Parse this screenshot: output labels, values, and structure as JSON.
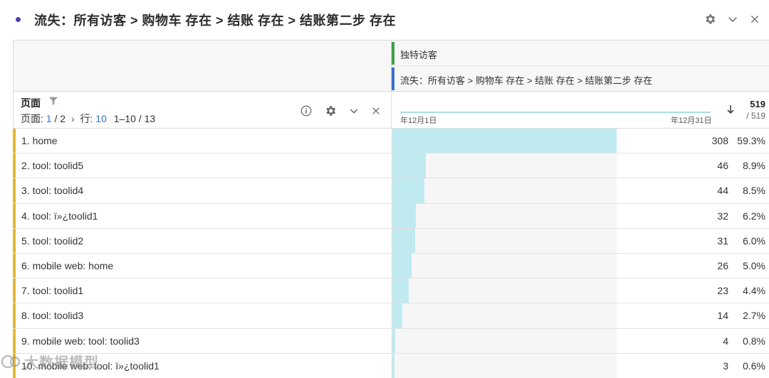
{
  "panel": {
    "title": "流失：所有访客 > 购物车 存在 > 结账 存在 > 结账第二步 存在",
    "icons": [
      "gear-icon",
      "chevron-down-icon",
      "close-icon"
    ]
  },
  "metrics": {
    "primary": "独特访客",
    "segment": "流失：所有访客 > 购物车 存在 > 结账 存在 > 结账第二步 存在",
    "primary_color": "#3fa14a",
    "segment_color": "#3b6fd0"
  },
  "dimension": {
    "title": "页面",
    "pager": {
      "page_label": "页面:",
      "page_current": "1",
      "page_total": "/ 2",
      "rows_label": "行:",
      "rows_per_page": "10",
      "range": "1–10 / 13"
    }
  },
  "trend": {
    "start_date": "年12月1日",
    "end_date": "年12月31日",
    "total": "519",
    "total_of": "/ 519"
  },
  "rows": [
    {
      "label": "1.  home",
      "count": "308",
      "pct": "59.3%",
      "share": 0.593
    },
    {
      "label": "2.  tool: toolid5",
      "count": "46",
      "pct": "8.9%",
      "share": 0.089
    },
    {
      "label": "3.  tool: toolid4",
      "count": "44",
      "pct": "8.5%",
      "share": 0.085
    },
    {
      "label": "4.  tool: ï»¿toolid1",
      "count": "32",
      "pct": "6.2%",
      "share": 0.062
    },
    {
      "label": "5.  tool: toolid2",
      "count": "31",
      "pct": "6.0%",
      "share": 0.06
    },
    {
      "label": "6.  mobile web: home",
      "count": "26",
      "pct": "5.0%",
      "share": 0.05
    },
    {
      "label": "7.  tool: toolid1",
      "count": "23",
      "pct": "4.4%",
      "share": 0.044
    },
    {
      "label": "8.  tool: toolid3",
      "count": "14",
      "pct": "2.7%",
      "share": 0.027
    },
    {
      "label": "9.  mobile web: tool: toolid3",
      "count": "4",
      "pct": "0.8%",
      "share": 0.008
    },
    {
      "label": "10.  mobile web: tool: ï»¿toolid1",
      "count": "3",
      "pct": "0.6%",
      "share": 0.006
    }
  ],
  "colors": {
    "row_accent": "#e5b92e",
    "bar_fill": "#bfeaf0",
    "link": "#2f6fce"
  },
  "watermark": {
    "text": "大数据模型"
  }
}
